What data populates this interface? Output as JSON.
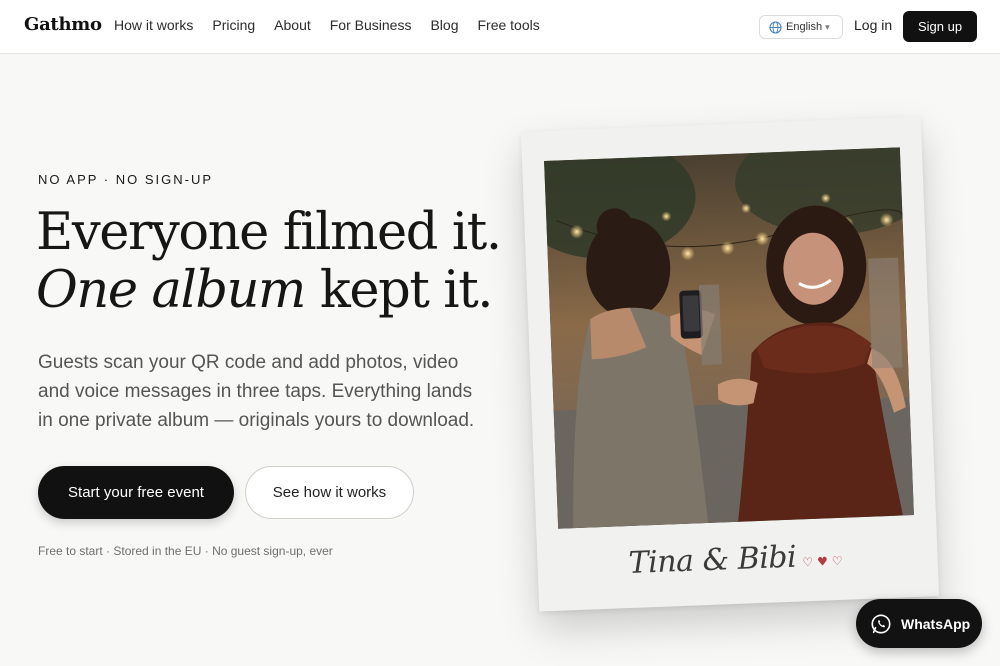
{
  "nav": {
    "logo": "Gathmo",
    "links": [
      "How it works",
      "Pricing",
      "About",
      "For Business",
      "Blog",
      "Free tools"
    ],
    "language": "English",
    "login": "Log in",
    "signup": "Sign up"
  },
  "hero": {
    "eyebrow": "NO APP · NO SIGN-UP",
    "headline_line1": "Everyone filmed it.",
    "headline_line2_italic": "One album",
    "headline_line2_rest": " kept it.",
    "body": "Guests scan your QR code and add photos, video and voice messages in three taps. Everything lands in one private album — originals yours to download.",
    "primary_cta": "Start your free event",
    "secondary_cta": "See how it works",
    "fineprint": "Free to start · Stored in the EU · No guest sign-up, ever"
  },
  "polaroid": {
    "caption": "Tina & Bibi",
    "hearts": "♡♥♡"
  },
  "chat": {
    "label": "WhatsApp"
  },
  "colors": {
    "primary": "#111111",
    "background": "#f8f8f7",
    "accent_heart": "#b43a45"
  }
}
